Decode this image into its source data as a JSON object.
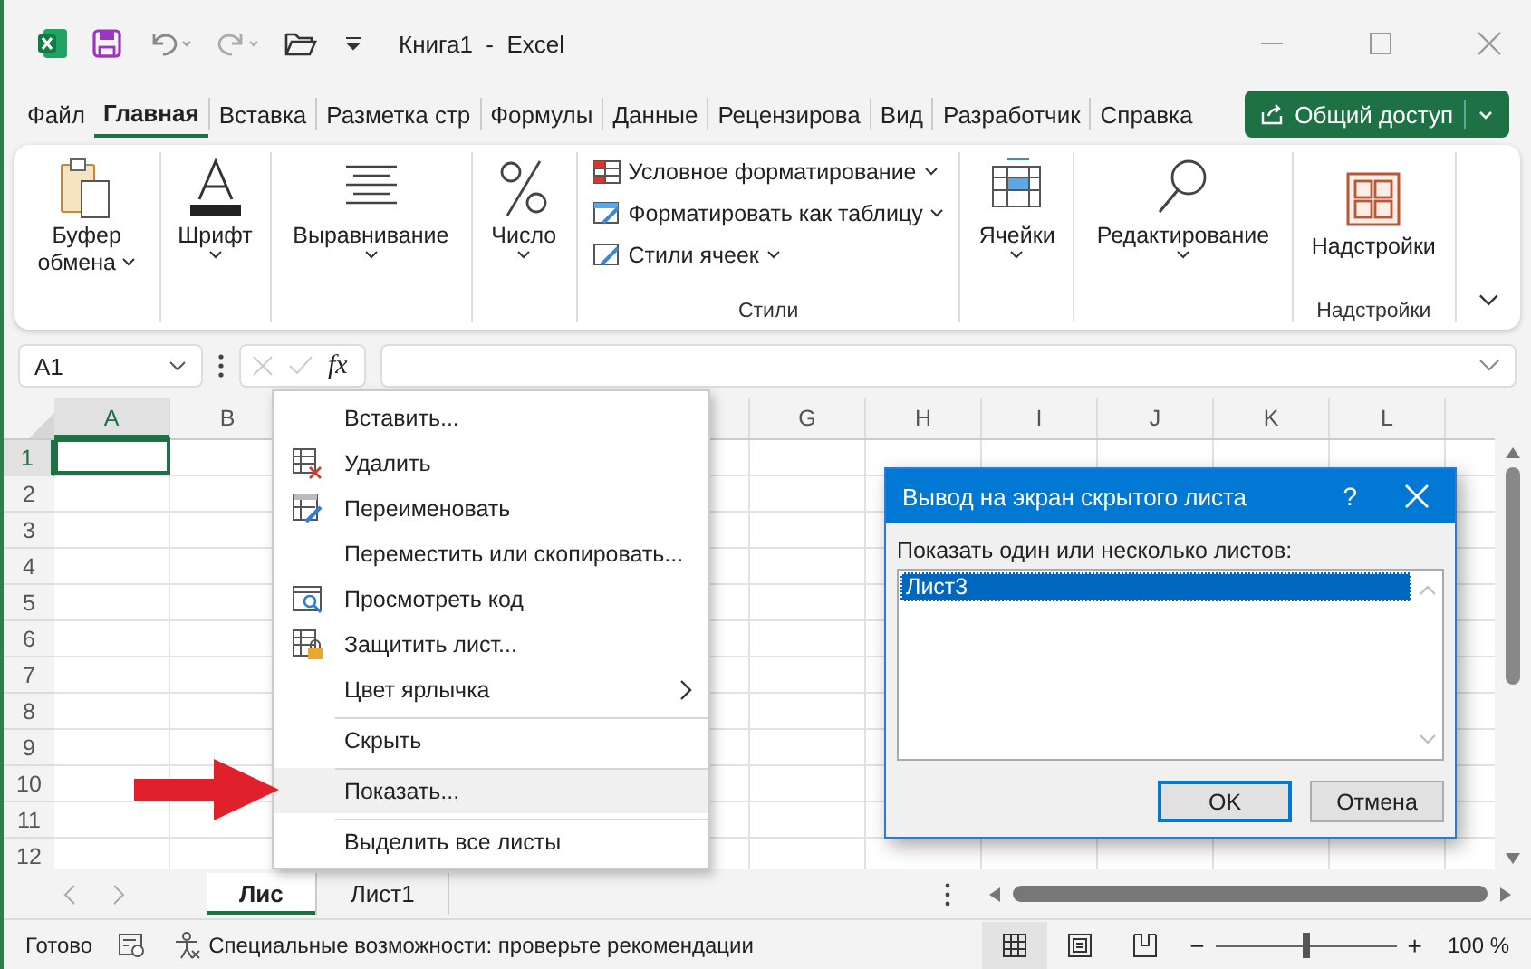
{
  "window": {
    "title": "Книга1  -  Excel"
  },
  "tabs": [
    {
      "label": "Файл",
      "selected": false
    },
    {
      "label": "Главная",
      "selected": true
    },
    {
      "label": "Вставка",
      "selected": false
    },
    {
      "label": "Разметка стр",
      "selected": false
    },
    {
      "label": "Формулы",
      "selected": false
    },
    {
      "label": "Данные",
      "selected": false
    },
    {
      "label": "Рецензирова",
      "selected": false
    },
    {
      "label": "Вид",
      "selected": false
    },
    {
      "label": "Разработчик",
      "selected": false
    },
    {
      "label": "Справка",
      "selected": false
    }
  ],
  "share_button": {
    "label": "Общий доступ"
  },
  "ribbon": {
    "groups": [
      {
        "kind": "clipboard",
        "label": "Буфер",
        "label2": "обмена"
      },
      {
        "kind": "font",
        "label": "Шрифт"
      },
      {
        "kind": "alignment",
        "label": "Выравнивание"
      },
      {
        "kind": "number",
        "label": "Число"
      },
      {
        "kind": "styles",
        "name": "Стили",
        "items": [
          {
            "kind": "conditional",
            "label": "Условное форматирование"
          },
          {
            "kind": "table",
            "label": "Форматировать как таблицу"
          },
          {
            "kind": "cellstyles",
            "label": "Стили ячеек"
          }
        ]
      },
      {
        "kind": "cells",
        "label": "Ячейки"
      },
      {
        "kind": "editing",
        "label": "Редактирование"
      },
      {
        "kind": "addins",
        "label": "Надстройки",
        "name": "Надстройки"
      }
    ]
  },
  "formula_bar": {
    "name_box": "A1",
    "fx": "fx"
  },
  "grid": {
    "columns": [
      {
        "label": "A",
        "selected": true
      },
      {
        "label": "B",
        "selected": false
      },
      {
        "label": "G",
        "selected": false
      },
      {
        "label": "H",
        "selected": false
      },
      {
        "label": "I",
        "selected": false
      },
      {
        "label": "J",
        "selected": false
      },
      {
        "label": "K",
        "selected": false
      },
      {
        "label": "L",
        "selected": false
      }
    ],
    "rows": [
      {
        "label": "1",
        "selected": true
      },
      {
        "label": "2",
        "selected": false
      },
      {
        "label": "3",
        "selected": false
      },
      {
        "label": "4",
        "selected": false
      },
      {
        "label": "5",
        "selected": false
      },
      {
        "label": "6",
        "selected": false
      },
      {
        "label": "7",
        "selected": false
      },
      {
        "label": "8",
        "selected": false
      },
      {
        "label": "9",
        "selected": false
      },
      {
        "label": "10",
        "selected": false
      },
      {
        "label": "11",
        "selected": false
      },
      {
        "label": "12",
        "selected": false
      }
    ]
  },
  "context_menu": {
    "items": [
      {
        "label": "Вставить...",
        "kind": "plain",
        "submenu": false,
        "separator_before": false,
        "highlighted": false
      },
      {
        "label": "Удалить",
        "kind": "delete",
        "submenu": false,
        "separator_before": false,
        "highlighted": false
      },
      {
        "label": "Переименовать",
        "kind": "rename",
        "submenu": false,
        "separator_before": false,
        "highlighted": false
      },
      {
        "label": "Переместить или скопировать...",
        "kind": "plain",
        "submenu": false,
        "separator_before": false,
        "highlighted": false
      },
      {
        "label": "Просмотреть код",
        "kind": "code",
        "submenu": false,
        "separator_before": false,
        "highlighted": false
      },
      {
        "label": "Защитить лист...",
        "kind": "protect",
        "submenu": false,
        "separator_before": false,
        "highlighted": false
      },
      {
        "label": "Цвет ярлычка",
        "kind": "plain",
        "submenu": true,
        "separator_before": false,
        "highlighted": false
      },
      {
        "label": "Скрыть",
        "kind": "plain",
        "submenu": false,
        "separator_before": true,
        "highlighted": false
      },
      {
        "label": "Показать...",
        "kind": "plain",
        "submenu": false,
        "separator_before": true,
        "highlighted": true
      },
      {
        "label": "Выделить все листы",
        "kind": "plain",
        "submenu": false,
        "separator_before": true,
        "highlighted": false
      }
    ]
  },
  "dialog": {
    "title": "Вывод на экран скрытого листа",
    "help": "?",
    "prompt": "Показать один или несколько листов:",
    "sheets": [
      {
        "label": "Лист3",
        "selected": true
      }
    ],
    "buttons": [
      {
        "label": "OK",
        "default": true
      },
      {
        "label": "Отмена",
        "default": false
      }
    ]
  },
  "sheet_tabs": [
    {
      "label": "Лис",
      "selected": true
    },
    {
      "label": "Лист1",
      "selected": false
    }
  ],
  "status_bar": {
    "status": "Готово",
    "accessibility": "Специальные возможности: проверьте рекомендации",
    "views": [
      {
        "kind": "normal",
        "selected": true
      },
      {
        "kind": "page_layout",
        "selected": false
      },
      {
        "kind": "page_break",
        "selected": false
      }
    ],
    "zoom_out": "−",
    "zoom_in": "+",
    "zoom": {
      "level": 0.5,
      "reading": "100 %"
    }
  }
}
